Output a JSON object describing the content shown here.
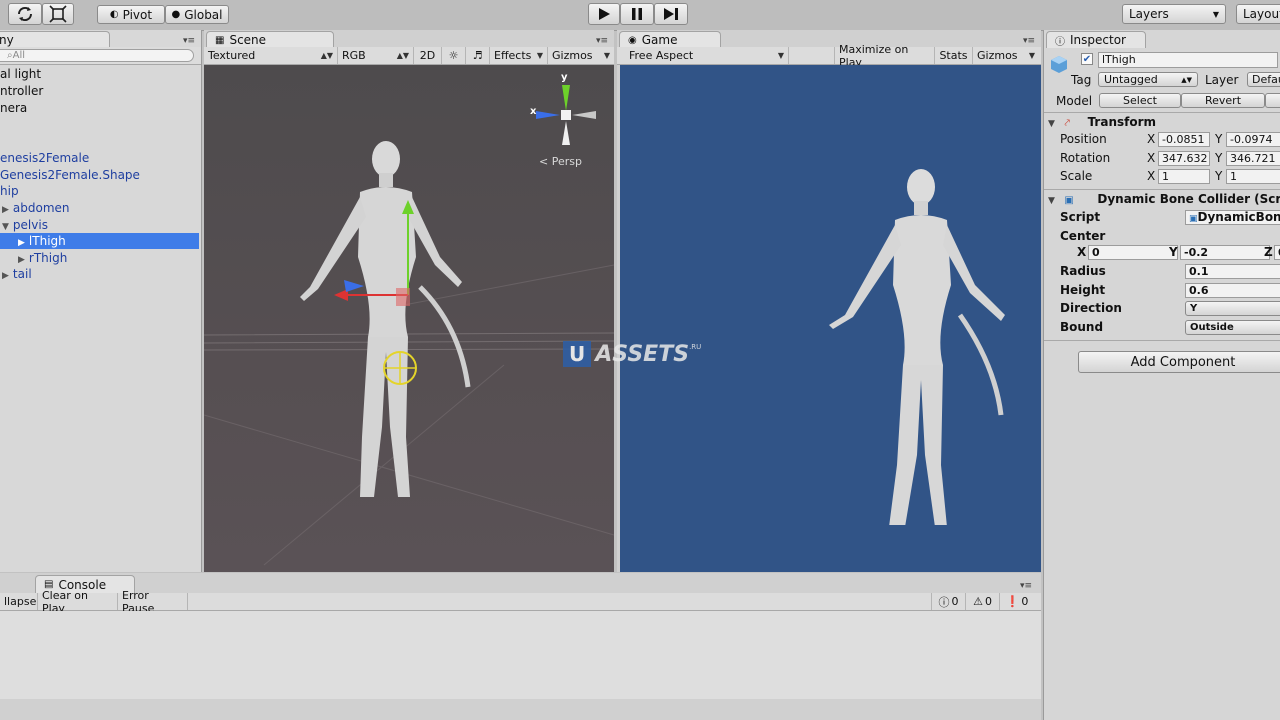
{
  "toolbar": {
    "pivot_label": "Pivot",
    "global_label": "Global",
    "layers_label": "Layers",
    "layout_label": "Layout"
  },
  "hierarchy": {
    "tab_label": "ny",
    "search_placeholder": "All",
    "items": [
      "al light",
      "ntroller",
      "nera",
      "enesis2Female",
      "Genesis2Female.Shape",
      "hip",
      "abdomen",
      "pelvis",
      "lThigh",
      "rThigh",
      "tail"
    ]
  },
  "scene": {
    "tab_label": "Scene",
    "shading": "Textured",
    "rgb": "RGB",
    "mode2d": "2D",
    "effects": "Effects",
    "gizmos": "Gizmos",
    "gizmo_y": "y",
    "gizmo_x": "x",
    "persp": "Persp"
  },
  "game": {
    "tab_label": "Game",
    "aspect": "Free Aspect",
    "maximize": "Maximize on Play",
    "stats": "Stats",
    "gizmos": "Gizmos",
    "bg_color": "#315487"
  },
  "watermark": {
    "u": "U",
    "text": "ASSETS",
    "ru": ".RU"
  },
  "inspector": {
    "tab_label": "Inspector",
    "object_name": "lThigh",
    "tag_label": "Tag",
    "tag_value": "Untagged",
    "layer_label": "Layer",
    "layer_value": "Defau",
    "model_label": "Model",
    "select_label": "Select",
    "revert_label": "Revert",
    "transform": {
      "title": "Transform",
      "position_label": "Position",
      "rotation_label": "Rotation",
      "scale_label": "Scale",
      "x": "X",
      "y": "Y",
      "position_x": "-0.0851",
      "position_y": "-0.0974",
      "rotation_x": "347.632",
      "rotation_y": "346.721",
      "scale_x": "1",
      "scale_y": "1"
    },
    "collider": {
      "title": "Dynamic Bone Collider (Scr",
      "script_label": "Script",
      "script_value": "DynamicBon",
      "center_label": "Center",
      "cx_label": "X",
      "cx_value": "0",
      "cy_label": "Y",
      "cy_value": "-0.2",
      "cz_label": "Z",
      "cz_value": "0",
      "radius_label": "Radius",
      "radius_value": "0.1",
      "height_label": "Height",
      "height_value": "0.6",
      "direction_label": "Direction",
      "direction_value": "Y",
      "bound_label": "Bound",
      "bound_value": "Outside"
    },
    "add_component": "Add Component"
  },
  "console": {
    "tab_label": "Console",
    "collapse": "llapse",
    "clear_on_play": "Clear on Play",
    "error_pause": "Error Pause",
    "info_count": "0",
    "warn_count": "0",
    "error_count": "0"
  }
}
